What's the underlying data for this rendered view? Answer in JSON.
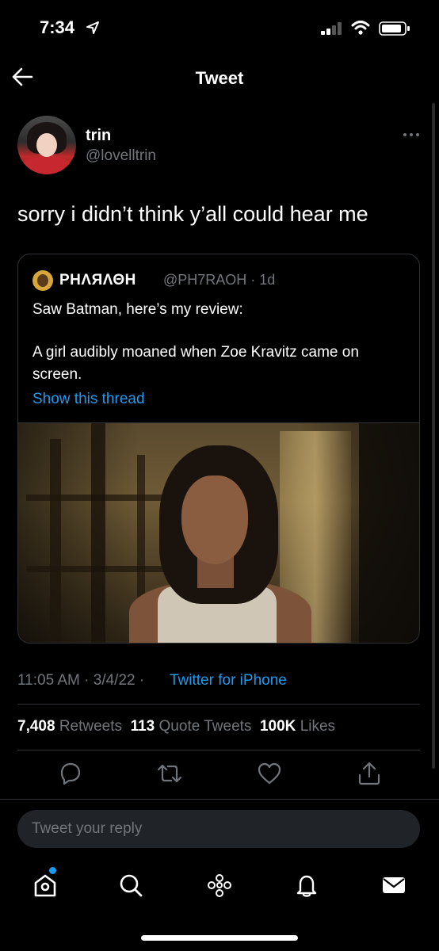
{
  "status_bar": {
    "time": "7:34"
  },
  "header": {
    "title": "Tweet"
  },
  "tweet": {
    "author_name": "trin",
    "author_handle": "@lovelltrin",
    "text": "sorry i didn’t think y’all could hear me",
    "timestamp": "11:05 AM · 3/4/22 ·",
    "source": "Twitter for iPhone"
  },
  "quoted_tweet": {
    "author_name": "PHΛЯΛΘH",
    "author_handle": "@PH7RAOH · 1d",
    "line1": "Saw Batman, here’s my review:",
    "line2": "A girl audibly moaned when Zoe Kravitz came on screen.",
    "thread_link": "Show this thread"
  },
  "stats": {
    "retweets_count": "7,408",
    "retweets_label": "Retweets",
    "quotes_count": "113",
    "quotes_label": "Quote Tweets",
    "likes_count": "100K",
    "likes_label": "Likes"
  },
  "reply": {
    "placeholder": "Tweet your reply"
  },
  "icons": {
    "back": "arrow-left-icon",
    "more": "ellipsis-icon",
    "actions": [
      "reply-icon",
      "retweet-icon",
      "like-icon",
      "share-icon"
    ],
    "nav": [
      "home-icon",
      "search-icon",
      "spaces-icon",
      "notifications-icon",
      "messages-icon"
    ]
  },
  "colors": {
    "background": "#000000",
    "accent": "#1d9bf0",
    "muted": "#71767b",
    "divider": "#2f3336"
  }
}
